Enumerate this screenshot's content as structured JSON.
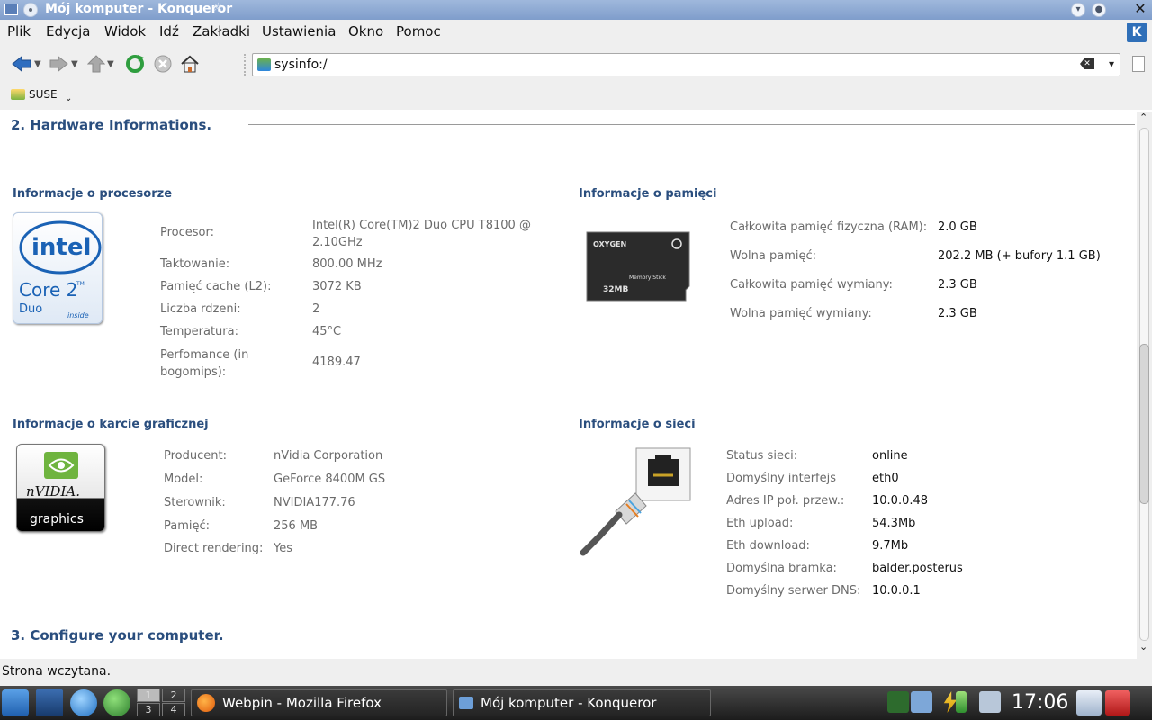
{
  "window": {
    "title": "Mój komputer - Konqueror",
    "swirl": "☼"
  },
  "menu": [
    "Plik",
    "Edycja",
    "Widok",
    "Idź",
    "Zakładki",
    "Ustawienia",
    "Okno",
    "Pomoc"
  ],
  "location": {
    "url": "sysinfo:/"
  },
  "bookmarks": {
    "items": [
      "SUSE"
    ]
  },
  "sections": {
    "hardware_title": "2. Hardware Informations.",
    "configure_title": "3. Configure your computer."
  },
  "cpu": {
    "title": "Informacje o procesorze",
    "logo_text": {
      "brand": "intel",
      "model": "Core 2",
      "sup": "TM",
      "variant": "Duo",
      "tag": "inside"
    },
    "rows": [
      {
        "label": "Procesor:",
        "value": "Intel(R) Core(TM)2 Duo CPU T8100 @ 2.10GHz"
      },
      {
        "label": "Taktowanie:",
        "value": "800.00 MHz"
      },
      {
        "label": "Pamięć cache (L2):",
        "value": "3072 KB"
      },
      {
        "label": "Liczba rdzeni:",
        "value": "2"
      },
      {
        "label": "Temperatura:",
        "value": "45°C"
      },
      {
        "label": "Perfomance (in bogomips):",
        "value": "4189.47"
      }
    ]
  },
  "memory": {
    "title": "Informacje o pamięci",
    "logo_text": {
      "brand": "OXYGEN",
      "product": "Memory Stick",
      "size": "32MB"
    },
    "rows": [
      {
        "label": "Całkowita pamięć fizyczna (RAM):",
        "value": "2.0 GB"
      },
      {
        "label": "Wolna pamięć:",
        "value": "202.2 MB (+ bufory 1.1 GB)"
      },
      {
        "label": "Całkowita pamięć wymiany:",
        "value": "2.3 GB"
      },
      {
        "label": "Wolna pamięć wymiany:",
        "value": "2.3 GB"
      }
    ]
  },
  "gpu": {
    "title": "Informacje o karcie graficznej",
    "logo_text": {
      "brand": "nVIDIA.",
      "tag": "graphics"
    },
    "rows": [
      {
        "label": "Producent:",
        "value": "nVidia Corporation"
      },
      {
        "label": "Model:",
        "value": "GeForce 8400M GS"
      },
      {
        "label": "Sterownik:",
        "value": "NVIDIA177.76"
      },
      {
        "label": "Pamięć:",
        "value": "256 MB"
      },
      {
        "label": "Direct rendering:",
        "value": "Yes"
      }
    ]
  },
  "network": {
    "title": "Informacje o sieci",
    "rows": [
      {
        "label": "Status sieci:",
        "value": "online"
      },
      {
        "label": "Domyślny interfejs",
        "value": "eth0"
      },
      {
        "label": "Adres IP poł. przew.:",
        "value": "10.0.0.48"
      },
      {
        "label": "Eth upload:",
        "value": "54.3Mb"
      },
      {
        "label": "Eth download:",
        "value": "9.7Mb"
      },
      {
        "label": "Domyślna bramka:",
        "value": "balder.posterus"
      },
      {
        "label": "Domyślny serwer DNS:",
        "value": "10.0.0.1"
      }
    ]
  },
  "status": "Strona wczytana.",
  "taskbar": {
    "pager": [
      "1",
      "2",
      "3",
      "4"
    ],
    "tasks": [
      "Webpin - Mozilla Firefox",
      "Mój komputer - Konqueror"
    ],
    "clock": "17:06"
  },
  "colors": {
    "heading": "#2a4e7e",
    "label": "#6b6b6b",
    "titlebar": "#8aa6d2"
  }
}
